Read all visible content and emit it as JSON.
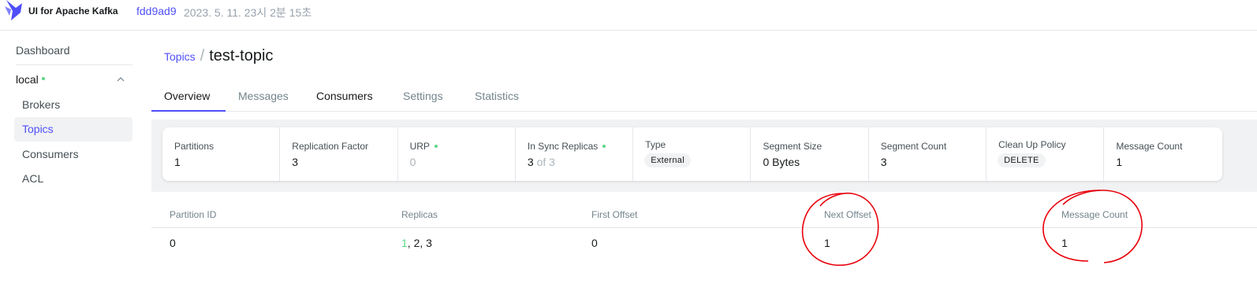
{
  "header": {
    "app_title": "UI for Apache Kafka",
    "commit": "fdd9ad9",
    "build_date": "2023. 5. 11. 23시 2분 15초"
  },
  "sidebar": {
    "dashboard": "Dashboard",
    "cluster": {
      "name": "local",
      "status_color": "#5cd685"
    },
    "items": [
      {
        "label": "Brokers",
        "active": false
      },
      {
        "label": "Topics",
        "active": true
      },
      {
        "label": "Consumers",
        "active": false
      },
      {
        "label": "ACL",
        "active": false
      }
    ]
  },
  "breadcrumb": {
    "parent": "Topics",
    "separator": "/",
    "current": "test-topic"
  },
  "tabs": [
    "Overview",
    "Messages",
    "Consumers",
    "Settings",
    "Statistics"
  ],
  "active_tab": "Overview",
  "stats": {
    "partitions": {
      "label": "Partitions",
      "value": "1"
    },
    "replication_factor": {
      "label": "Replication Factor",
      "value": "3"
    },
    "urp": {
      "label": "URP",
      "value": "0"
    },
    "in_sync_replicas": {
      "label": "In Sync Replicas",
      "value": "3",
      "of": "of 3"
    },
    "type": {
      "label": "Type",
      "value": "External"
    },
    "segment_size": {
      "label": "Segment Size",
      "value": "0 Bytes"
    },
    "segment_count": {
      "label": "Segment Count",
      "value": "3"
    },
    "cleanup_policy": {
      "label": "Clean Up Policy",
      "value": "DELETE"
    },
    "message_count": {
      "label": "Message Count",
      "value": "1"
    }
  },
  "partitions_table": {
    "columns": [
      "Partition ID",
      "Replicas",
      "First Offset",
      "Next Offset",
      "Message Count"
    ],
    "rows": [
      {
        "partition_id": "0",
        "replicas_leader": "1",
        "replicas_rest": ", 2, 3",
        "first_offset": "0",
        "next_offset": "1",
        "message_count": "1"
      }
    ]
  },
  "colors": {
    "accent": "#4f4ffa",
    "ok": "#5cd685",
    "annotation": "#e8000a"
  },
  "icons": {
    "logo": "kafka-logo-icon",
    "chevron": "chevron-up-icon"
  }
}
